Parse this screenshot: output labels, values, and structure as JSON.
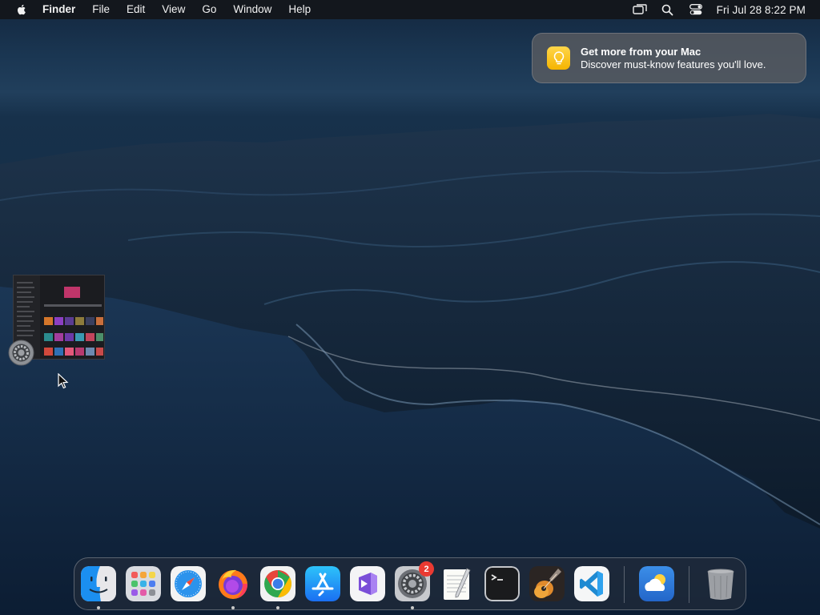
{
  "menubar": {
    "app_name": "Finder",
    "menus": [
      "File",
      "Edit",
      "View",
      "Go",
      "Window",
      "Help"
    ],
    "status_icons": [
      "screen-mirroring-icon",
      "spotlight-search-icon",
      "control-center-icon"
    ],
    "clock": "Fri Jul 28  8:22 PM"
  },
  "notification": {
    "icon": "lightbulb-icon",
    "title": "Get more from your Mac",
    "body": "Discover must-know features you'll love."
  },
  "floating_window": {
    "app_icon": "system-settings-icon"
  },
  "dock": {
    "apps": [
      {
        "name": "Finder",
        "icon": "finder-icon",
        "running": true
      },
      {
        "name": "Launchpad",
        "icon": "launchpad-icon",
        "running": false
      },
      {
        "name": "Safari",
        "icon": "safari-icon",
        "running": false
      },
      {
        "name": "Firefox",
        "icon": "firefox-icon",
        "running": true
      },
      {
        "name": "Google Chrome",
        "icon": "chrome-icon",
        "running": true
      },
      {
        "name": "App Store",
        "icon": "app-store-icon",
        "running": false
      },
      {
        "name": "Visual Studio",
        "icon": "visual-studio-icon",
        "running": false
      },
      {
        "name": "System Settings",
        "icon": "system-settings-icon",
        "running": true
      },
      {
        "name": "TextEdit",
        "icon": "textedit-icon",
        "running": false
      },
      {
        "name": "Terminal",
        "icon": "terminal-icon",
        "running": false
      },
      {
        "name": "GarageBand",
        "icon": "garageband-icon",
        "running": false
      },
      {
        "name": "Visual Studio Code",
        "icon": "vscode-icon",
        "running": false
      },
      {
        "name": "Weather",
        "icon": "weather-icon",
        "running": false
      },
      {
        "name": "Trash",
        "icon": "trash-icon",
        "running": false
      }
    ],
    "settings_badge": "2"
  },
  "colors": {
    "menubar_bg": "#141619",
    "notification_bg": "#5c5e62",
    "badge_red": "#ea3a32",
    "notification_icon_yellow": "#f5b400"
  }
}
